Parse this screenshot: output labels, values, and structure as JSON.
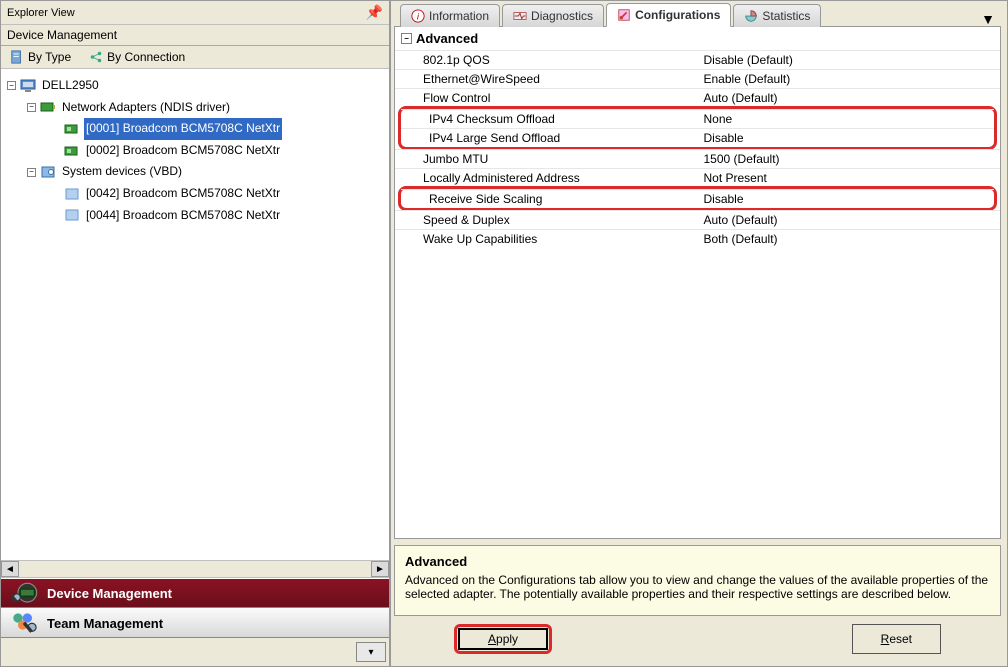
{
  "explorer": {
    "title": "Explorer View",
    "subtitle": "Device Management",
    "modes": {
      "byType": "By Type",
      "byConnection": "By Connection"
    },
    "tree": {
      "root": "DELL2950",
      "netAdapters": "Network Adapters (NDIS driver)",
      "na1": "[0001] Broadcom BCM5708C NetXtr",
      "na2": "[0002] Broadcom BCM5708C NetXtr",
      "sysDevices": "System devices (VBD)",
      "sd1": "[0042] Broadcom BCM5708C NetXtr",
      "sd2": "[0044] Broadcom BCM5708C NetXtr"
    },
    "navDevice": "Device Management",
    "navTeam": "Team Management"
  },
  "tabs": {
    "info": "Information",
    "diag": "Diagnostics",
    "config": "Configurations",
    "stats": "Statistics"
  },
  "advanced": {
    "title": "Advanced",
    "rows": {
      "r0n": "802.1p QOS",
      "r0v": "Disable (Default)",
      "r1n": "Ethernet@WireSpeed",
      "r1v": "Enable (Default)",
      "r2n": "Flow Control",
      "r2v": "Auto (Default)",
      "r3n": "IPv4 Checksum Offload",
      "r3v": "None",
      "r4n": "IPv4 Large Send Offload",
      "r4v": "Disable",
      "r5n": "Jumbo MTU",
      "r5v": "1500 (Default)",
      "r6n": "Locally Administered Address",
      "r6v": "Not Present",
      "r7n": "Receive Side Scaling",
      "r7v": "Disable",
      "r8n": "Speed & Duplex",
      "r8v": "Auto (Default)",
      "r9n": "Wake Up Capabilities",
      "r9v": "Both (Default)"
    }
  },
  "help": {
    "title": "Advanced",
    "body": "Advanced on the Configurations tab allow you to view and change the values of the available properties of the selected adapter. The potentially available properties and their respective settings are described below."
  },
  "buttons": {
    "apply": "Apply",
    "reset": "Reset"
  }
}
